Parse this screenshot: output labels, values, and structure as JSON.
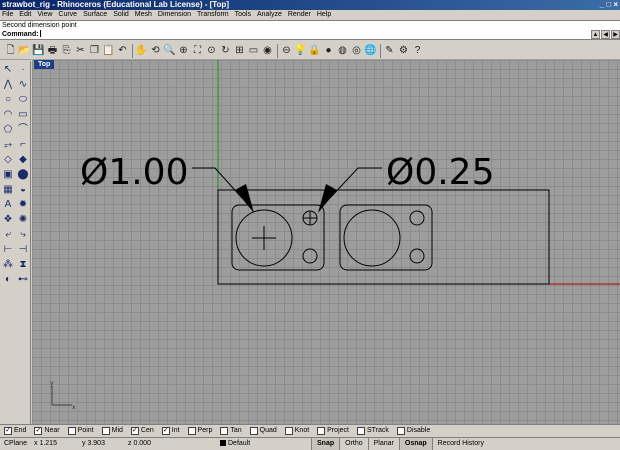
{
  "window": {
    "title": "strawbot_rig - Rhinoceros (Educational Lab License) - [Top]",
    "controls": [
      "_",
      "□",
      "×"
    ]
  },
  "menu": [
    "File",
    "Edit",
    "View",
    "Curve",
    "Surface",
    "Solid",
    "Mesh",
    "Dimension",
    "Transform",
    "Tools",
    "Analyze",
    "Render",
    "Help"
  ],
  "command": {
    "history": "Second dimension point",
    "prompt": "Command:"
  },
  "toolbar_icons": [
    "new-icon",
    "open-icon",
    "save-icon",
    "print-icon",
    "import-icon",
    "cut-icon",
    "copy-icon",
    "paste-icon",
    "undo-icon",
    "pan-icon",
    "rotate-view-icon",
    "zoom-icon",
    "zoom-window-icon",
    "zoom-extents-icon",
    "zoom-selected-icon",
    "redraw-icon",
    "four-views-icon",
    "cplane-icon",
    "show-icon",
    "select-icon",
    "light-icon",
    "lock-icon",
    "shade-icon",
    "render-icon",
    "sphere-icon",
    "globe-icon",
    "properties-icon",
    "options-icon",
    "help-icon"
  ],
  "viewport": {
    "name": "Top",
    "dimensions": [
      "Ø1.00",
      "Ø0.25"
    ],
    "axis_y": "y",
    "axis_x": "x",
    "colors": {
      "x_axis": "#c00000",
      "y_axis": "#1a8a1a",
      "grid_major": "#8d8d8d",
      "background": "#9d9d9d"
    }
  },
  "osnaps": [
    {
      "label": "End",
      "checked": true
    },
    {
      "label": "Near",
      "checked": true
    },
    {
      "label": "Point",
      "checked": false
    },
    {
      "label": "Mid",
      "checked": false
    },
    {
      "label": "Cen",
      "checked": true
    },
    {
      "label": "Int",
      "checked": true
    },
    {
      "label": "Perp",
      "checked": false
    },
    {
      "label": "Tan",
      "checked": false
    },
    {
      "label": "Quad",
      "checked": false
    },
    {
      "label": "Knot",
      "checked": false
    },
    {
      "label": "Project",
      "checked": false
    },
    {
      "label": "STrack",
      "checked": false
    },
    {
      "label": "Disable",
      "checked": false
    }
  ],
  "status": {
    "cplane": "CPlane",
    "x": "x 1.215",
    "y": "y 3.903",
    "z": "z 0.000",
    "layer": "Default",
    "buttons": [
      {
        "label": "Snap",
        "on": true
      },
      {
        "label": "Ortho",
        "on": false
      },
      {
        "label": "Planar",
        "on": false
      },
      {
        "label": "Osnap",
        "on": true
      },
      {
        "label": "Record History",
        "on": false
      }
    ]
  }
}
